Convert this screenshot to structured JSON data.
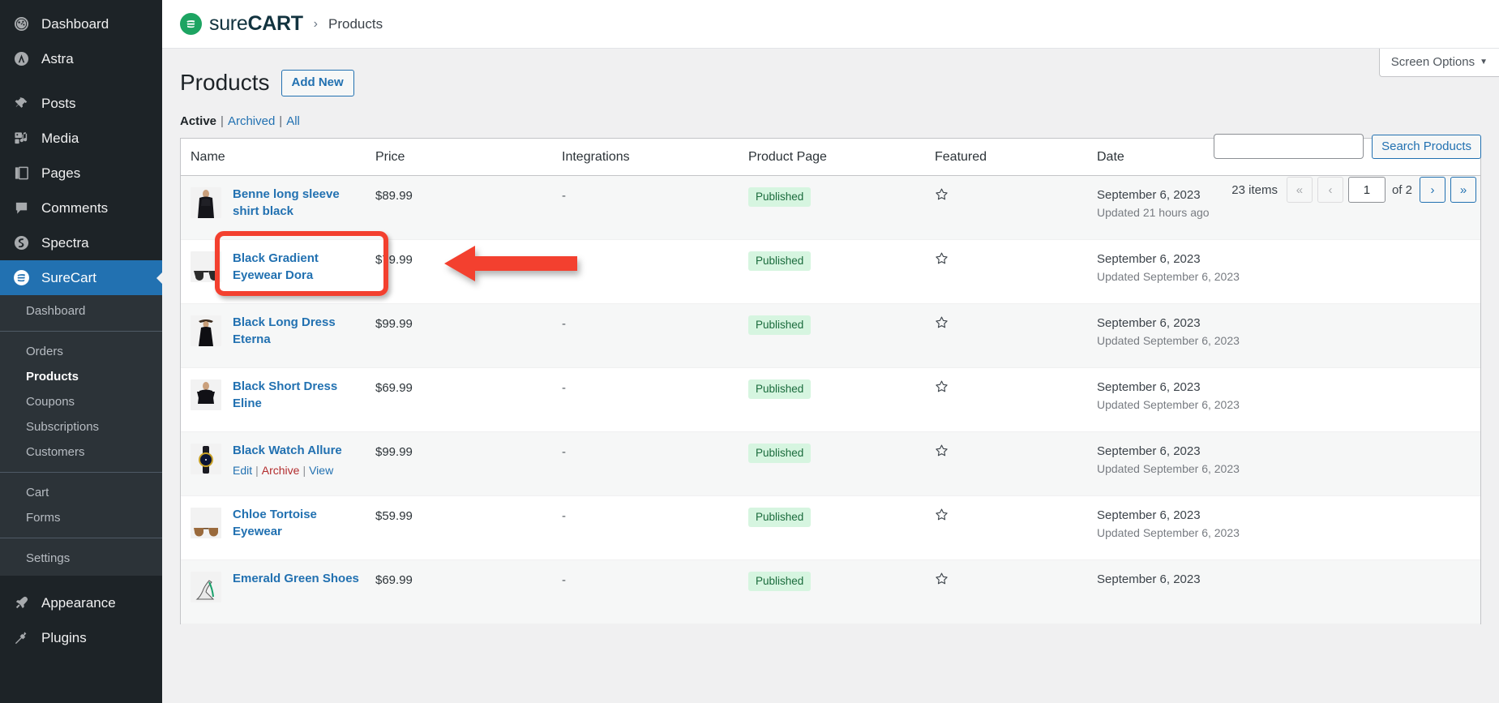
{
  "sidebar": {
    "top_items": [
      {
        "label": "Dashboard",
        "icon": "dashboard-icon"
      },
      {
        "label": "Astra",
        "icon": "astra-icon"
      }
    ],
    "main_items": [
      {
        "label": "Posts",
        "icon": "pin-icon"
      },
      {
        "label": "Media",
        "icon": "media-icon"
      },
      {
        "label": "Pages",
        "icon": "pages-icon"
      },
      {
        "label": "Comments",
        "icon": "comment-icon"
      },
      {
        "label": "Spectra",
        "icon": "spectra-icon"
      }
    ],
    "current_item": {
      "label": "SureCart",
      "icon": "surecart-icon"
    },
    "submenu_groups": [
      [
        "Dashboard"
      ],
      [
        "Orders",
        "Products",
        "Coupons",
        "Subscriptions",
        "Customers"
      ],
      [
        "Cart",
        "Forms"
      ],
      [
        "Settings"
      ]
    ],
    "submenu_active": "Products",
    "bottom_items": [
      {
        "label": "Appearance",
        "icon": "appearance-icon"
      },
      {
        "label": "Plugins",
        "icon": "plugins-icon"
      }
    ]
  },
  "header": {
    "brand_prefix": "sure",
    "brand_suffix": "CART",
    "breadcrumb_separator": "›",
    "breadcrumb_current": "Products"
  },
  "screen_options": {
    "label": "Screen Options",
    "caret": "▼"
  },
  "page": {
    "title": "Products",
    "add_new_label": "Add New"
  },
  "search": {
    "value": "",
    "placeholder": "",
    "button_label": "Search Products"
  },
  "pagination": {
    "items_text": "23 items",
    "first_label": "«",
    "prev_label": "‹",
    "current_page": "1",
    "of_text": "of 2",
    "next_label": "›",
    "last_label": "»"
  },
  "filters": {
    "active": "Active",
    "archived": "Archived",
    "all": "All",
    "divider": "|"
  },
  "table": {
    "columns": [
      "Name",
      "Price",
      "Integrations",
      "Product Page",
      "Featured",
      "Date"
    ],
    "rows": [
      {
        "name": "Benne long sleeve shirt black",
        "price": "$89.99",
        "integrations": "-",
        "product_page": "Published",
        "featured_icon": "star-outline-icon",
        "date": "September 6, 2023",
        "updated": "Updated 21 hours ago",
        "thumb": "woman-black-shirt",
        "actions": []
      },
      {
        "name": "Black Gradient Eyewear Dora",
        "price": "$79.99",
        "integrations": "-",
        "product_page": "Published",
        "featured_icon": "star-outline-icon",
        "date": "September 6, 2023",
        "updated": "Updated September 6, 2023",
        "thumb": "black-sunglasses",
        "actions": []
      },
      {
        "name": "Black Long Dress Eterna",
        "price": "$99.99",
        "integrations": "-",
        "product_page": "Published",
        "featured_icon": "star-outline-icon",
        "date": "September 6, 2023",
        "updated": "Updated September 6, 2023",
        "thumb": "woman-long-dress",
        "actions": []
      },
      {
        "name": "Black Short Dress Eline",
        "price": "$69.99",
        "integrations": "-",
        "product_page": "Published",
        "featured_icon": "star-outline-icon",
        "date": "September 6, 2023",
        "updated": "Updated September 6, 2023",
        "thumb": "woman-short-dress",
        "actions": []
      },
      {
        "name": "Black Watch Allure",
        "price": "$99.99",
        "integrations": "-",
        "product_page": "Published",
        "featured_icon": "star-outline-icon",
        "date": "September 6, 2023",
        "updated": "Updated September 6, 2023",
        "thumb": "black-watch",
        "actions": [
          "Edit",
          "Archive",
          "View"
        ]
      },
      {
        "name": "Chloe Tortoise Eyewear",
        "price": "$59.99",
        "integrations": "-",
        "product_page": "Published",
        "featured_icon": "star-outline-icon",
        "date": "September 6, 2023",
        "updated": "Updated September 6, 2023",
        "thumb": "tortoise-sunglasses",
        "actions": []
      },
      {
        "name": "Emerald Green Shoes",
        "price": "$69.99",
        "integrations": "-",
        "product_page": "Published",
        "featured_icon": "star-outline-icon",
        "date": "September 6, 2023",
        "updated": "",
        "thumb": "green-shoe",
        "actions": []
      }
    ]
  },
  "annotations": {
    "highlight_color": "#f3402f",
    "highlight_target": "Benne long sleeve shirt black",
    "arrow_direction": "left"
  },
  "colors": {
    "admin_bg": "#1d2327",
    "admin_submenu_bg": "#2c3338",
    "accent_blue": "#2271b1",
    "brand_green": "#1da462",
    "published_bg": "#d6f5e0",
    "published_fg": "#1a6b3c"
  }
}
